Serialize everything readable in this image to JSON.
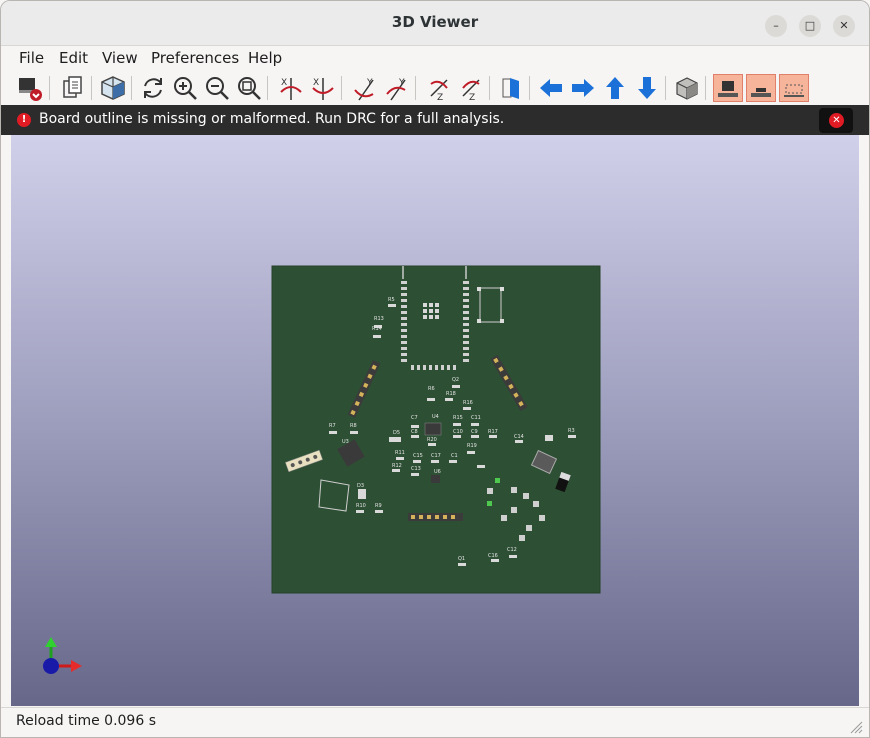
{
  "window": {
    "title": "3D Viewer",
    "buttons": [
      "–",
      "□",
      "✕"
    ]
  },
  "menu": [
    {
      "label": "File"
    },
    {
      "label": "Edit"
    },
    {
      "label": "View"
    },
    {
      "label": "Preferences"
    },
    {
      "label": "Help"
    }
  ],
  "toolbar": [
    "render-board-icon",
    "copy-image-icon",
    "3d-options-icon",
    "reload-icon",
    "zoom-in-icon",
    "zoom-out-icon",
    "zoom-fit-icon",
    "rotate-x-cw-icon",
    "rotate-x-ccw-icon",
    "rotate-y-cw-icon",
    "rotate-y-ccw-icon",
    "rotate-z-cw-icon",
    "rotate-z-ccw-icon",
    "flip-board-icon",
    "move-left-icon",
    "move-right-icon",
    "move-up-icon",
    "move-down-icon",
    "orthographic-icon",
    "show-tht-icon",
    "show-smd-icon",
    "show-virtual-icon"
  ],
  "infobar": {
    "message": "Board outline is missing or malformed. Run DRC for a full analysis."
  },
  "board": {
    "color": "#2d4f34",
    "labels": [
      "R5",
      "R13",
      "R14",
      "Q2",
      "R6",
      "R18",
      "R16",
      "U4",
      "C7",
      "C8",
      "R15",
      "C11",
      "C10",
      "C9",
      "R17",
      "R3",
      "C14",
      "D5",
      "R20",
      "C15",
      "C17",
      "C1",
      "R19",
      "U3",
      "R11",
      "R12",
      "C13",
      "U6",
      "R7",
      "R8",
      "D3",
      "R10",
      "R9",
      "C16",
      "C12",
      "Q1"
    ]
  },
  "status": {
    "reload": "Reload time 0.096 s"
  },
  "colors": {
    "accent": "#1c71d8",
    "error": "#e01b24",
    "active_toggle": "#f6b49b"
  }
}
